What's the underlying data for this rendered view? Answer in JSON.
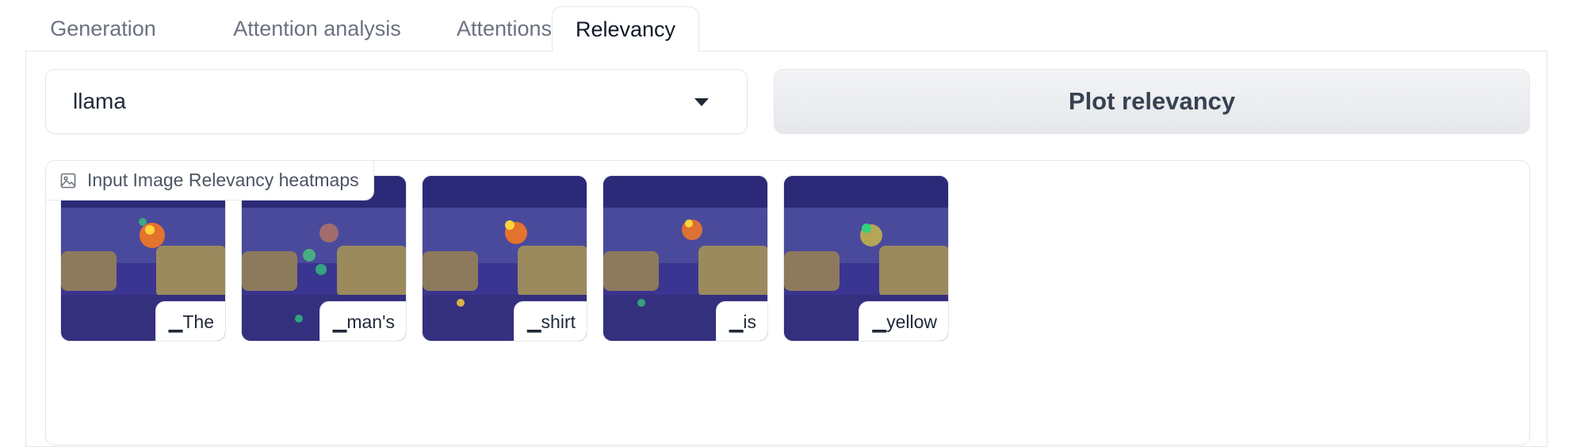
{
  "tabs": [
    {
      "label": "Generation"
    },
    {
      "label": "Attention analysis"
    },
    {
      "label": "Attentions"
    },
    {
      "label": "Relevancy"
    }
  ],
  "active_tab": "Relevancy",
  "controls": {
    "model_select_value": "llama",
    "plot_button_label": "Plot relevancy"
  },
  "gallery": {
    "label": "Input Image Relevancy heatmaps",
    "items": [
      {
        "caption": "▁The"
      },
      {
        "caption": "▁man's"
      },
      {
        "caption": "▁shirt"
      },
      {
        "caption": "▁is"
      },
      {
        "caption": "▁yellow"
      }
    ]
  },
  "colors": {
    "heatmap_overlay": "#2e2a8c",
    "taxi_yellow": "#d9b24a",
    "hot": "#ff7a1a"
  }
}
